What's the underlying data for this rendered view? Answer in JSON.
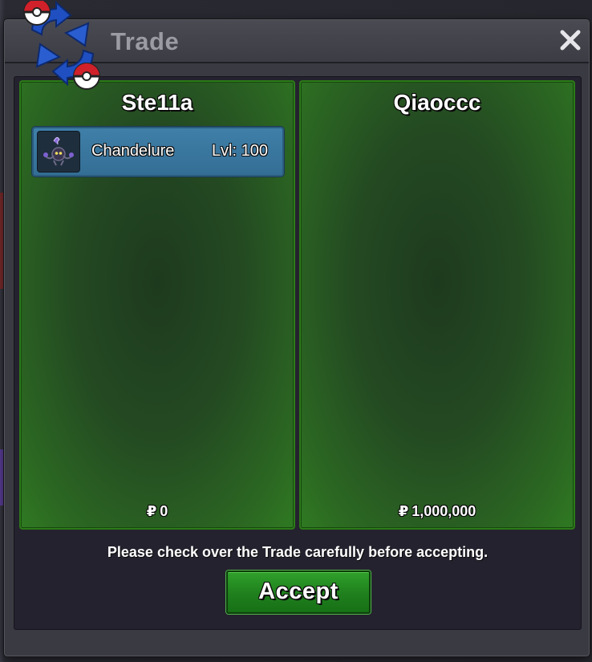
{
  "window": {
    "title": "Trade",
    "close_icon": "close-icon",
    "logo_icon": "trade-exchange-icon"
  },
  "left_panel": {
    "player_name": "Ste11a",
    "items": [
      {
        "icon": "chandelure-sprite-icon",
        "name": "Chandelure",
        "level": "Lvl: 100"
      }
    ],
    "currency_symbol": "₽",
    "money": "0"
  },
  "right_panel": {
    "player_name": "Qiaoccc",
    "items": [],
    "currency_symbol": "₽",
    "money": "1,000,000"
  },
  "footer": {
    "notice": "Please check over the Trade carefully before accepting.",
    "accept_label": "Accept"
  },
  "colors": {
    "panel_green": "#2f7a22",
    "accept_green": "#1f7f1d",
    "entry_blue": "#3f7fa8",
    "title_gray": "#9b9ba4"
  }
}
